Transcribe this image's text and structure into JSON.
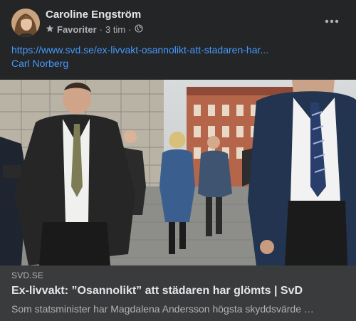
{
  "post": {
    "author": "Caroline Engström",
    "audience_label": "Favoriter",
    "separator": "·",
    "time": "3 tim",
    "separator2": "·",
    "icons": {
      "avatar": "avatar-photo",
      "favorites": "star-icon",
      "audience": "globe-icon",
      "more": "more-options-icon"
    },
    "link_text": "https://www.svd.se/ex-livvakt-osannolikt-att-stadaren-har...",
    "mention": "Carl Norberg"
  },
  "link_preview": {
    "domain": "SVD.SE",
    "title": "Ex-livvakt: ”Osannolikt” att städaren har glömts | SvD",
    "description": "Som statsminister har Magdalena Andersson högsta skyddsvärde …"
  },
  "colors": {
    "background": "#242526",
    "card": "#3a3b3c",
    "link": "#4599ff",
    "text_primary": "#e4e6eb",
    "text_secondary": "#b0b3b8"
  }
}
